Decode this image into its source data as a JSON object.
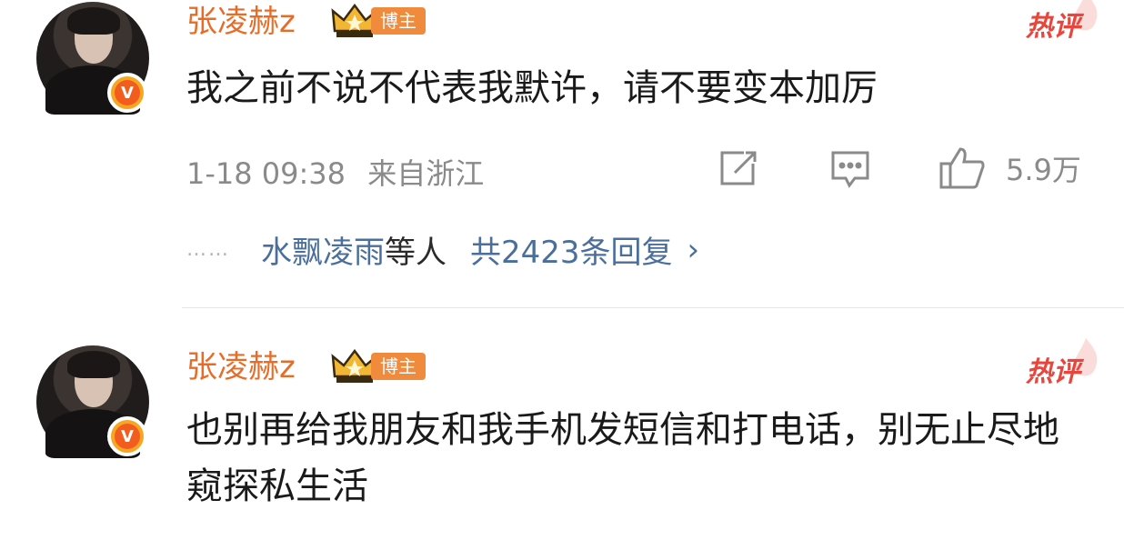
{
  "comments": [
    {
      "username": "张凌赫z",
      "role_badge": "博主",
      "hot_tag": "热评",
      "text": "我之前不说不代表我默许，请不要变本加厉",
      "time": "1-18 09:38",
      "location": "来自浙江",
      "like_count": "5.9万",
      "replies": {
        "dots": "……",
        "who": "水飘凌雨",
        "etc": "等人",
        "count": "共2423条回复",
        "chevron": "›"
      }
    },
    {
      "username": "张凌赫z",
      "role_badge": "博主",
      "hot_tag": "热评",
      "text": "也别再给我朋友和我手机发短信和打电话，别无止尽地窥探私生活"
    }
  ],
  "icons": {
    "verified": "verified-v-icon",
    "crown": "crown-icon",
    "repost": "repost-icon",
    "comment": "comment-icon",
    "like": "like-icon"
  },
  "colors": {
    "username": "#e86c27",
    "link": "#4a6f9c",
    "hot": "#e8453c",
    "meta": "#8a8a8a"
  }
}
